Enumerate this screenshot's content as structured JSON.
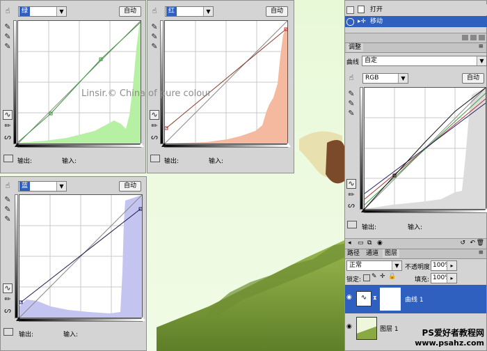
{
  "watermark": "Linsir.© China of pure colour",
  "panels": {
    "green": {
      "channel": "绿",
      "auto_label": "自动",
      "output_label": "输出:",
      "input_label": "输入:"
    },
    "red": {
      "channel": "红",
      "auto_label": "自动",
      "output_label": "输出:",
      "input_label": "输入:"
    },
    "blue": {
      "channel": "蓝",
      "auto_label": "自动",
      "output_label": "输出:",
      "input_label": "输入:"
    }
  },
  "history": {
    "items": [
      "打开",
      "移动"
    ]
  },
  "adjustments": {
    "tab": "调整",
    "preset_label": "曲线",
    "preset_value": "自定",
    "channel": "RGB",
    "auto_label": "自动",
    "output_label": "输出:",
    "input_label": "输入:"
  },
  "layers": {
    "tabs": [
      "路径",
      "通道",
      "图层"
    ],
    "blend_mode": "正常",
    "opacity_label": "不透明度:",
    "opacity_value": "100%",
    "lock_label": "锁定:",
    "fill_label": "填充:",
    "fill_value": "100%",
    "items": [
      {
        "name": "曲线 1",
        "selected": true
      },
      {
        "name": "图层 1",
        "selected": false
      }
    ]
  },
  "brand": {
    "line1": "PS爱好者教程网",
    "line2": "www.psahz.com"
  },
  "colors": {
    "selection": "#2f5fbf",
    "green_hist": "#b6f0a3",
    "red_hist": "#f5b9a0",
    "blue_hist": "#c4c4f1"
  }
}
